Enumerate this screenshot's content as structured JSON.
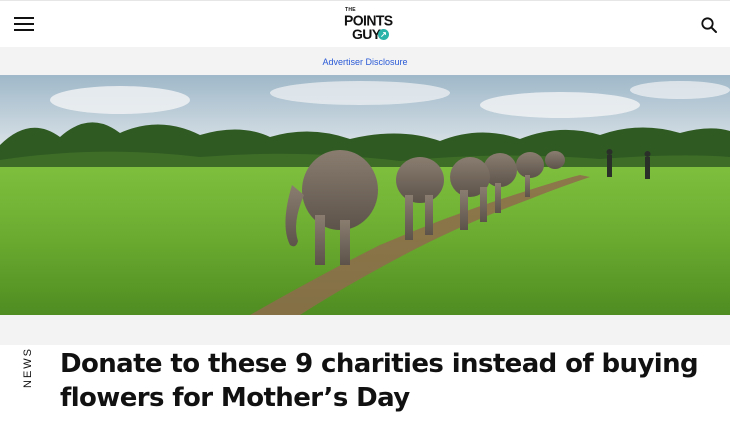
{
  "header": {
    "menu_icon": "hamburger-icon",
    "logo": {
      "line1": "THE",
      "line2": "POINTS",
      "line3": "GUY",
      "arrow_glyph": "↗"
    },
    "search_icon": "search-icon"
  },
  "disclosure": {
    "label": "Advertiser Disclosure"
  },
  "hero": {
    "image_icon": "hero-photo"
  },
  "article": {
    "category": "NEWS",
    "title_line1": "Donate to these 9 charities instead of buying",
    "title_line2": "flowers for Mother’s Day"
  },
  "colors": {
    "link_blue": "#2a5ad6",
    "brand_teal": "#2ab3a8"
  }
}
